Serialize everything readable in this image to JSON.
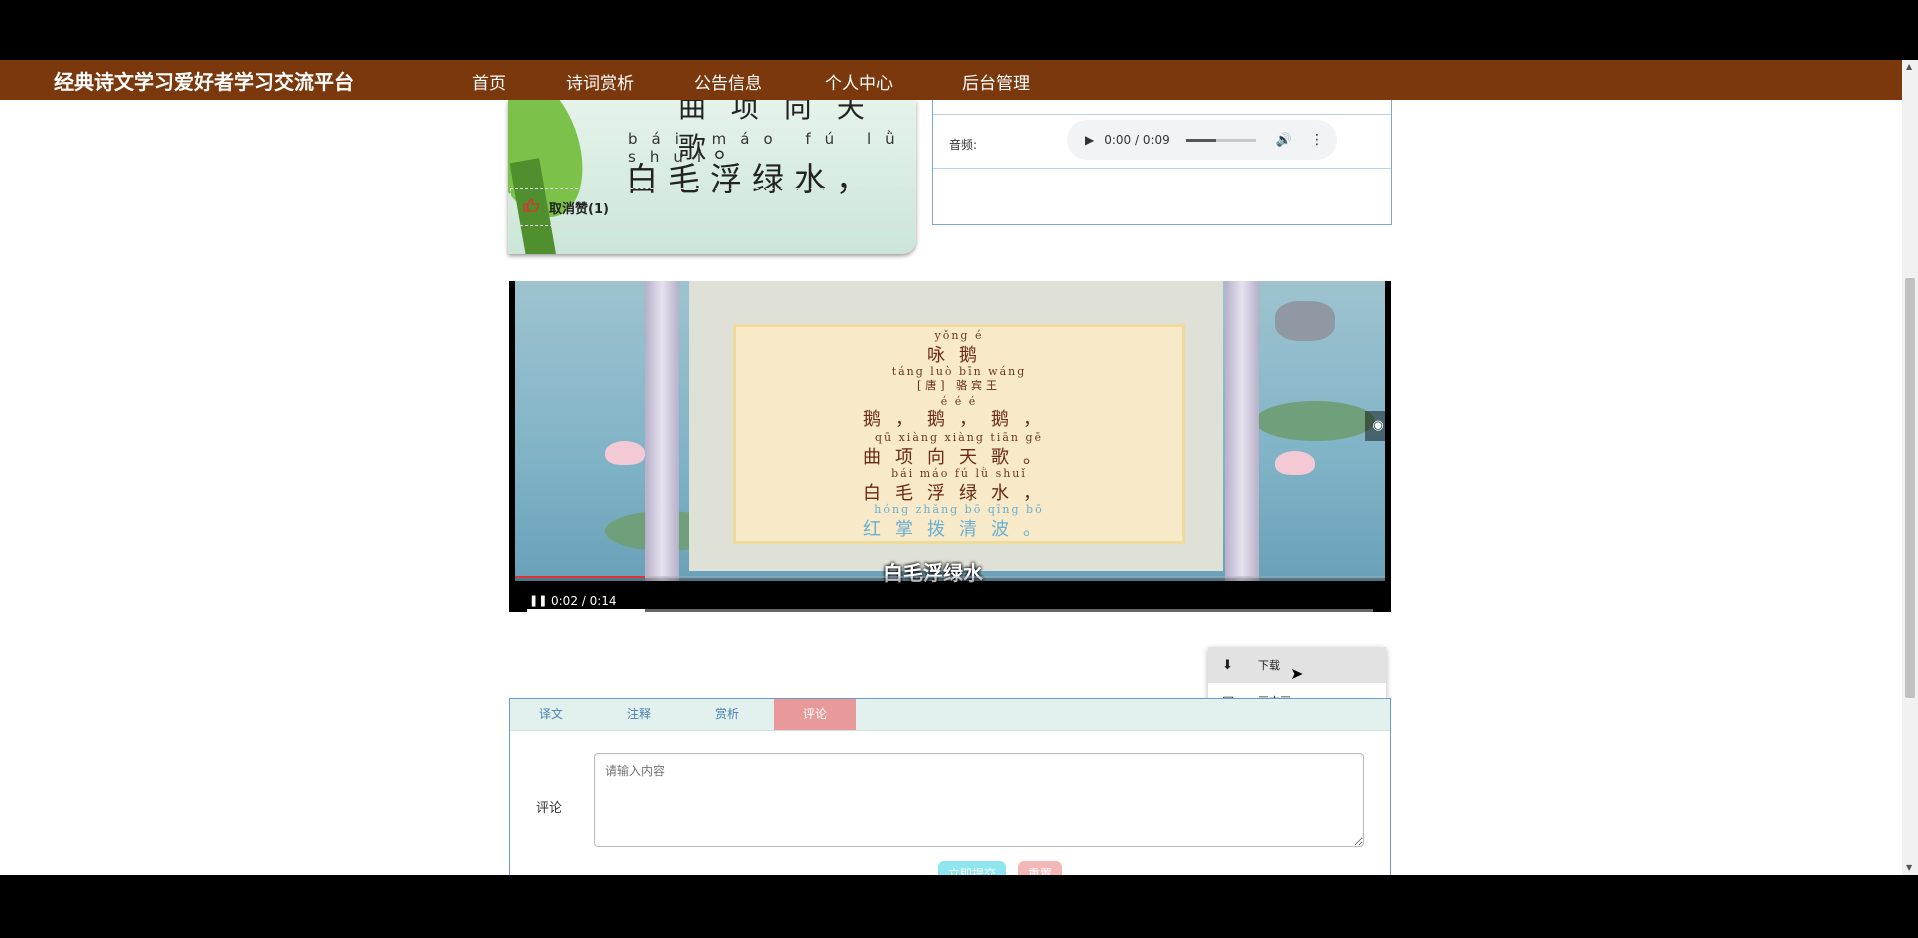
{
  "header": {
    "site_title": "经典诗文学习爱好者学习交流平台",
    "nav": [
      "首页",
      "诗词赏析",
      "公告信息",
      "个人中心",
      "后台管理"
    ]
  },
  "cover_image": {
    "top_text": "曲 项 向 天 歌。",
    "pinyin": "bái máo fú lǜ shuǐ",
    "line": "白毛浮绿水，"
  },
  "like": {
    "label": "取消赞(1)"
  },
  "audio": {
    "label": "音频:",
    "time": "0:00 / 0:09"
  },
  "video": {
    "poem": {
      "title_pinyin": "yǒng  é",
      "title": "咏鹅",
      "author_pinyin": "táng  luò bīn wáng",
      "author": "[唐] 骆宾王",
      "lines": [
        {
          "pinyin": "é     é     é",
          "text": "鹅，鹅，鹅，"
        },
        {
          "pinyin": "qū  xiàng xiàng tiān  gē",
          "text": "曲项向天歌。"
        },
        {
          "pinyin": "bái  máo   fú   lǜ   shuǐ",
          "text": "白毛浮绿水，"
        },
        {
          "pinyin": "hóng zhǎng  bō  qīng  bō",
          "text": "红掌拨清波。"
        }
      ]
    },
    "subtitle": "白毛浮绿水",
    "time": "0:02 / 0:14",
    "progress": 0.14
  },
  "context_menu": {
    "items": [
      "下载",
      "画中画"
    ]
  },
  "tabs": [
    "译文",
    "注释",
    "赏析",
    "评论"
  ],
  "comment": {
    "label": "评论",
    "placeholder": "请输入内容",
    "submit": "立即提交",
    "reset": "重置"
  }
}
